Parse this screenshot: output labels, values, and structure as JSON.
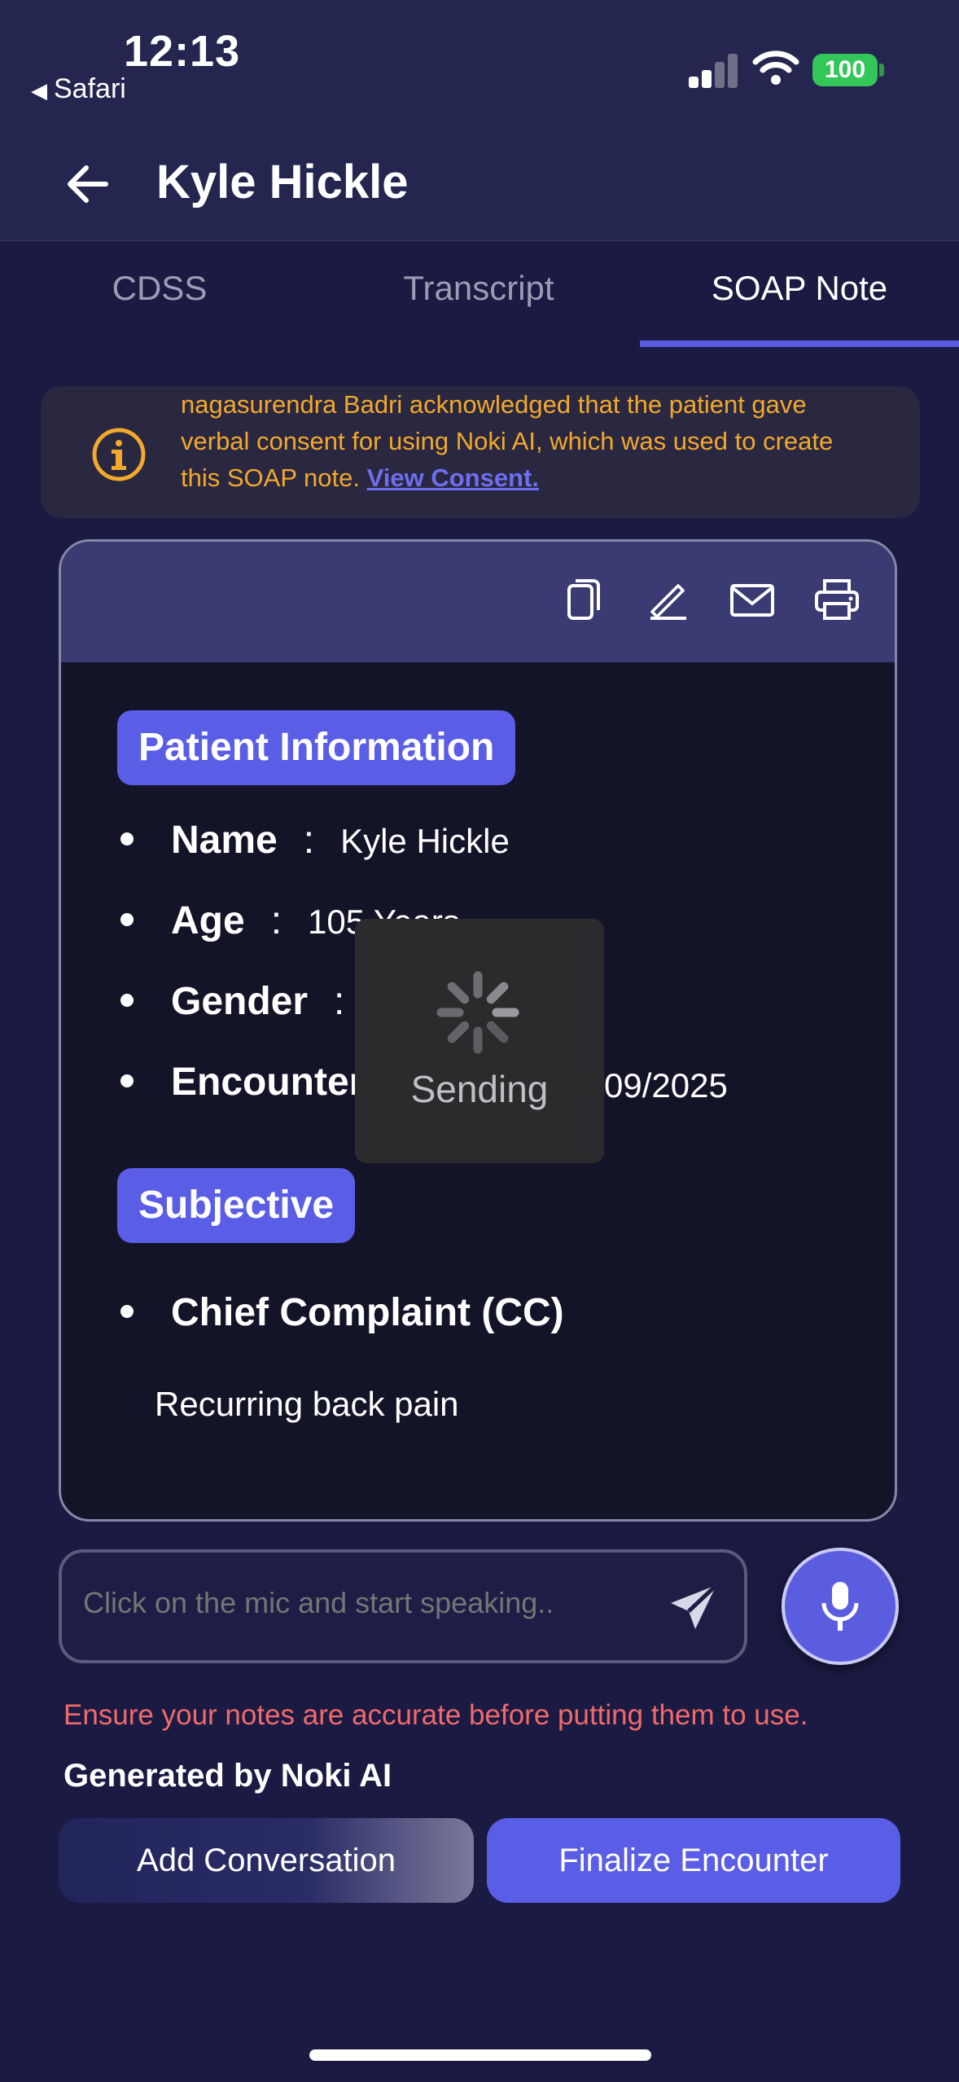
{
  "status_bar": {
    "time": "12:13",
    "back_app": "Safari",
    "battery": "100"
  },
  "header": {
    "title": "Kyle Hickle"
  },
  "tabs": [
    {
      "label": "CDSS",
      "active": false
    },
    {
      "label": "Transcript",
      "active": false
    },
    {
      "label": "SOAP Note",
      "active": true
    }
  ],
  "consent": {
    "line1": "nagasurendra Badri acknowledged that the patient gave",
    "line2": "verbal consent for using Noki AI, which was used to create",
    "line3": "this SOAP note. ",
    "link": "View Consent."
  },
  "toolbar_icons": [
    "copy-icon",
    "edit-icon",
    "mail-icon",
    "print-icon"
  ],
  "patient_info": {
    "heading": "Patient Information",
    "fields": [
      {
        "label": "Name",
        "sep": ":",
        "value": "Kyle Hickle"
      },
      {
        "label": "Age",
        "sep": ":",
        "value": "105 Years"
      },
      {
        "label": "Gender",
        "sep": ":",
        "value": ""
      },
      {
        "label": "Encounter",
        "sep": "",
        "value": "09/2025"
      }
    ]
  },
  "subjective": {
    "heading": "Subjective",
    "cc_label": "Chief Complaint (CC)",
    "cc_text": "Recurring back pain"
  },
  "overlay": {
    "label": "Sending"
  },
  "input": {
    "placeholder": "Click on the mic and start speaking.."
  },
  "footer": {
    "warning": "Ensure your notes are accurate before putting them to use.",
    "generated": "Generated by Noki AI",
    "add_label": "Add Conversation",
    "finalize_label": "Finalize Encounter"
  },
  "colors": {
    "accent": "#5a5de6",
    "background": "#1b1a42",
    "warning": "#f06a6a",
    "consent_text": "#f2a92c"
  }
}
